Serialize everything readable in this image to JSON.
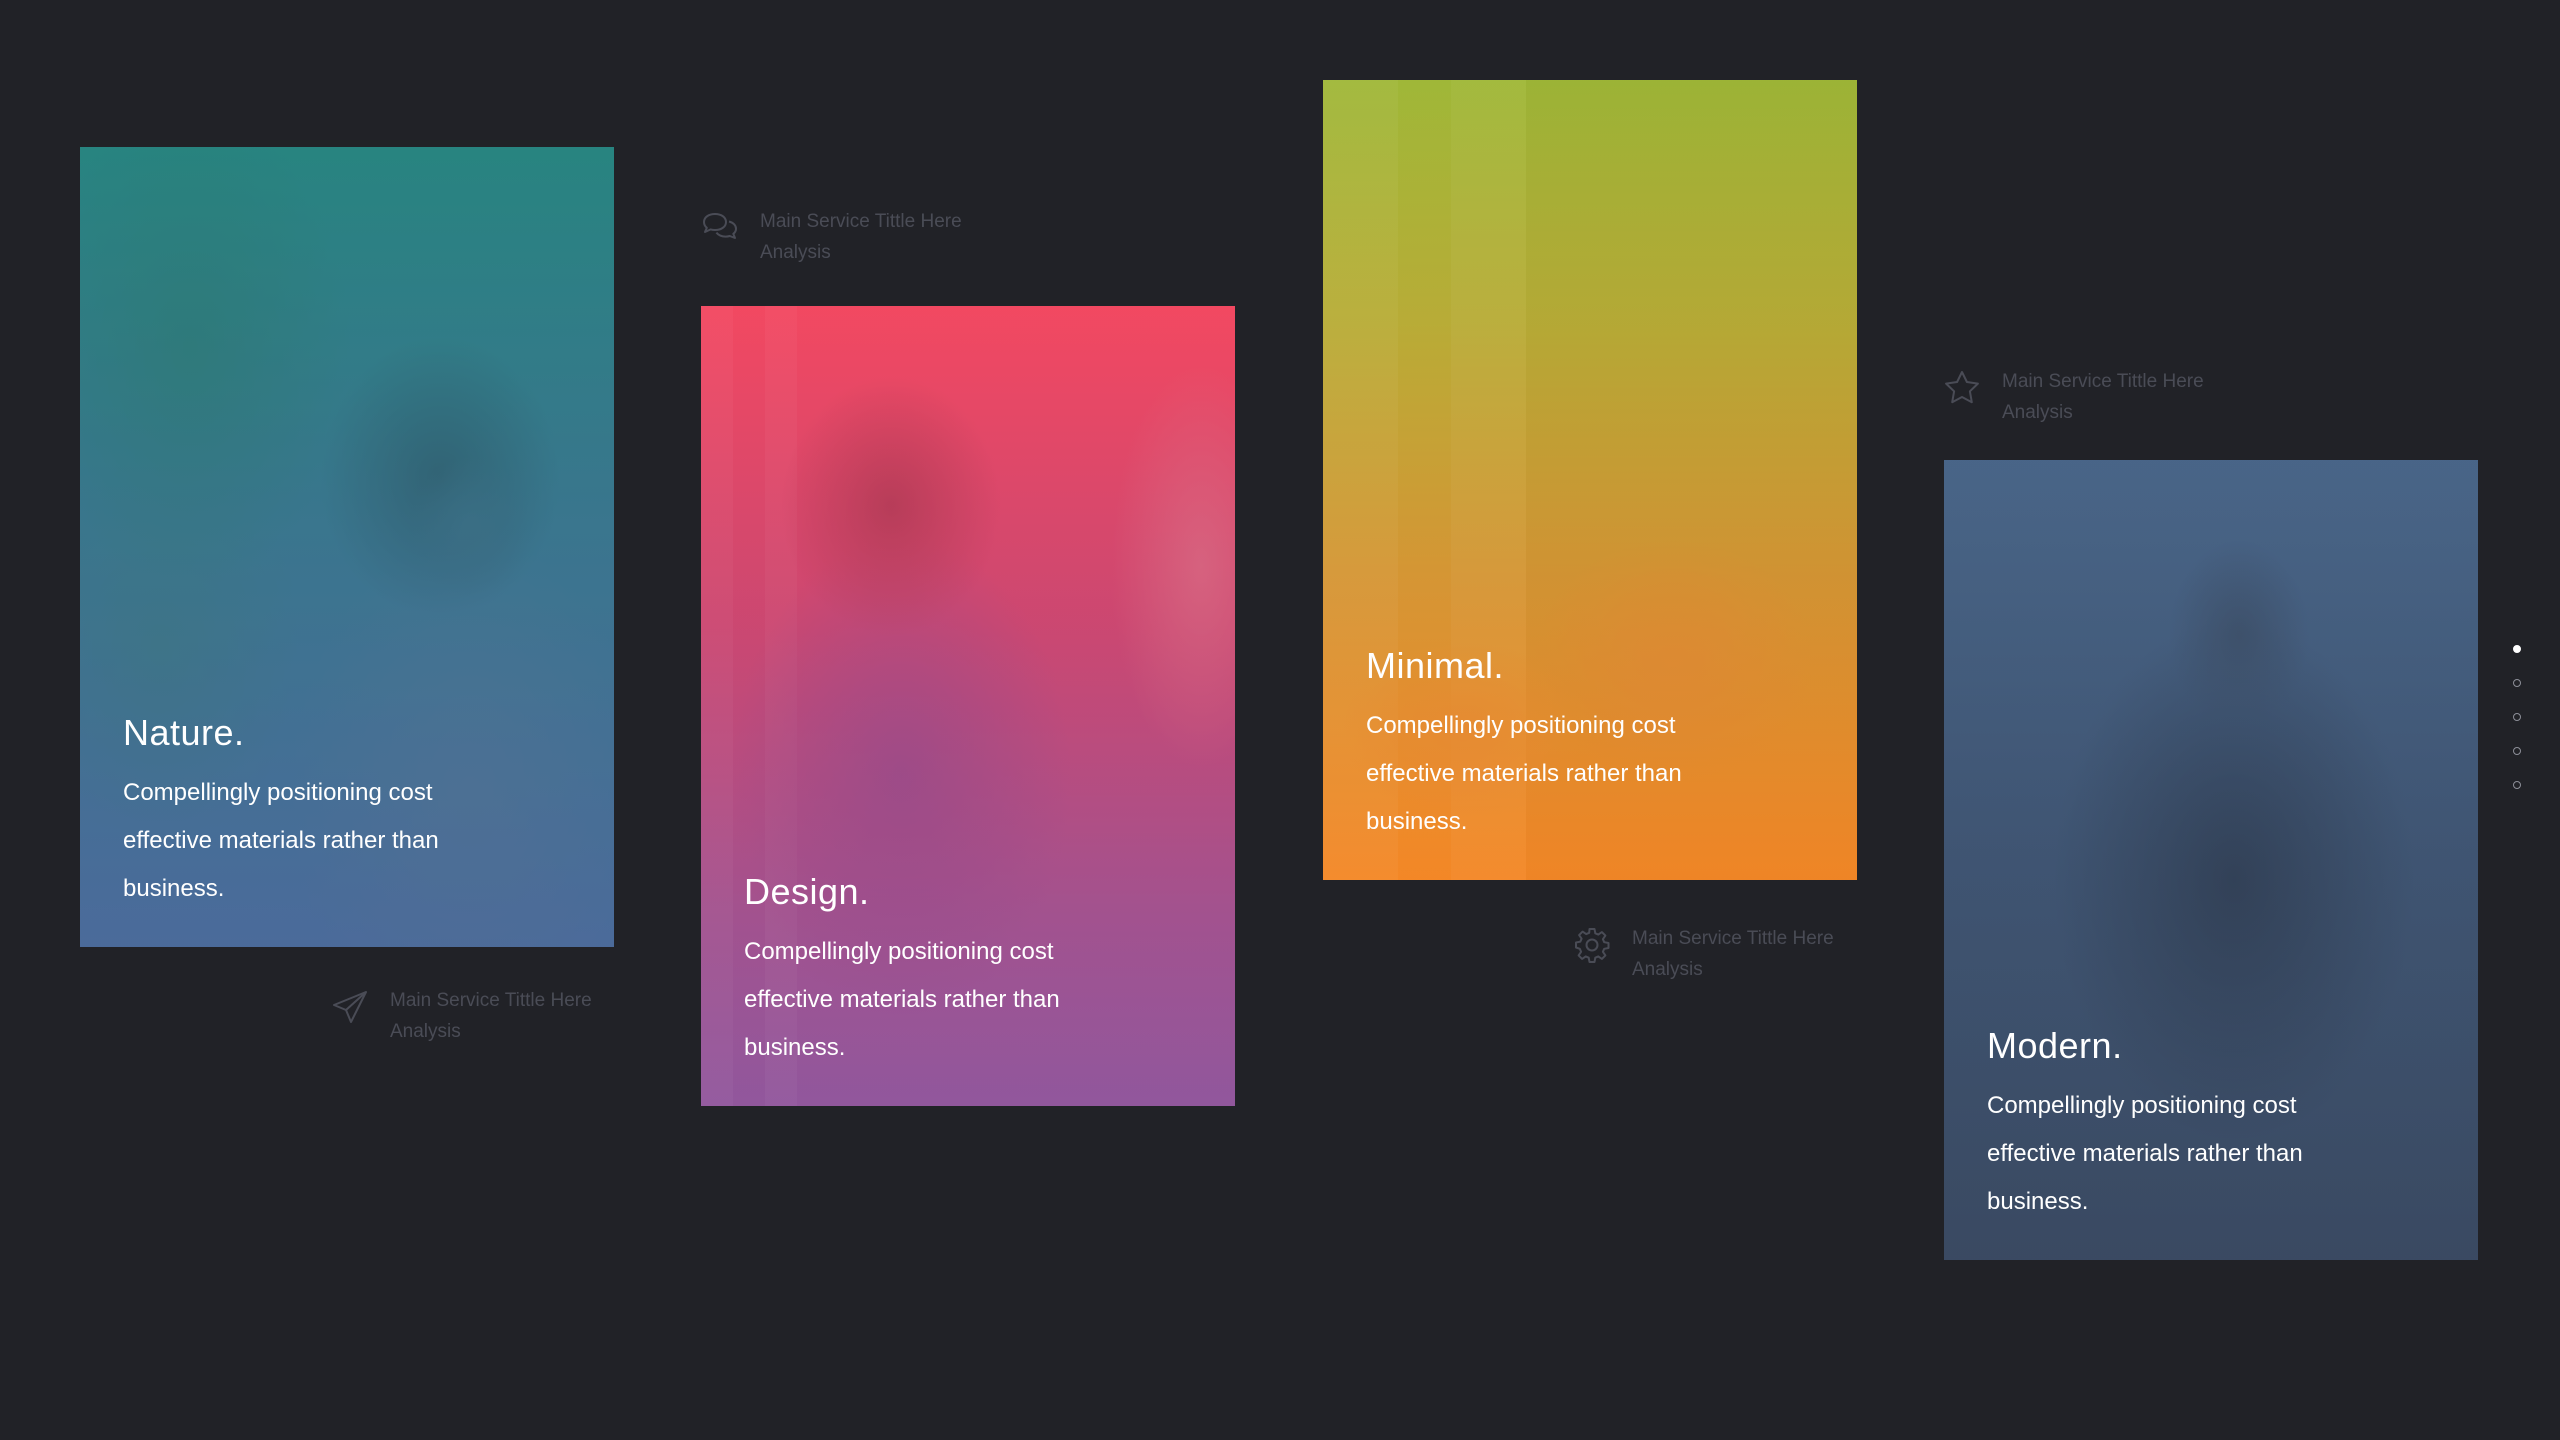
{
  "cards": [
    {
      "id": "nature",
      "title": "Nature.",
      "body": "Compellingly positioning cost effective materials rather than business."
    },
    {
      "id": "design",
      "title": "Design.",
      "body": "Compellingly positioning cost effective materials rather than business."
    },
    {
      "id": "minimal",
      "title": "Minimal.",
      "body": "Compellingly positioning cost effective materials rather than business."
    },
    {
      "id": "modern",
      "title": "Modern.",
      "body": "Compellingly positioning cost effective materials rather than business."
    }
  ],
  "services": [
    {
      "icon": "chat-bubbles-icon",
      "title": "Main Service Tittle Here",
      "subtitle": "Analysis"
    },
    {
      "icon": "paper-plane-icon",
      "title": "Main Service Tittle Here",
      "subtitle": "Analysis"
    },
    {
      "icon": "gear-icon",
      "title": "Main Service Tittle Here",
      "subtitle": "Analysis"
    },
    {
      "icon": "star-icon",
      "title": "Main Service Tittle Here",
      "subtitle": "Analysis"
    }
  ],
  "pagination": {
    "total": 5,
    "active_index": 0
  },
  "colors": {
    "background": "#212227",
    "caption_text": "#4a4c56",
    "card_text": "#ffffff"
  }
}
